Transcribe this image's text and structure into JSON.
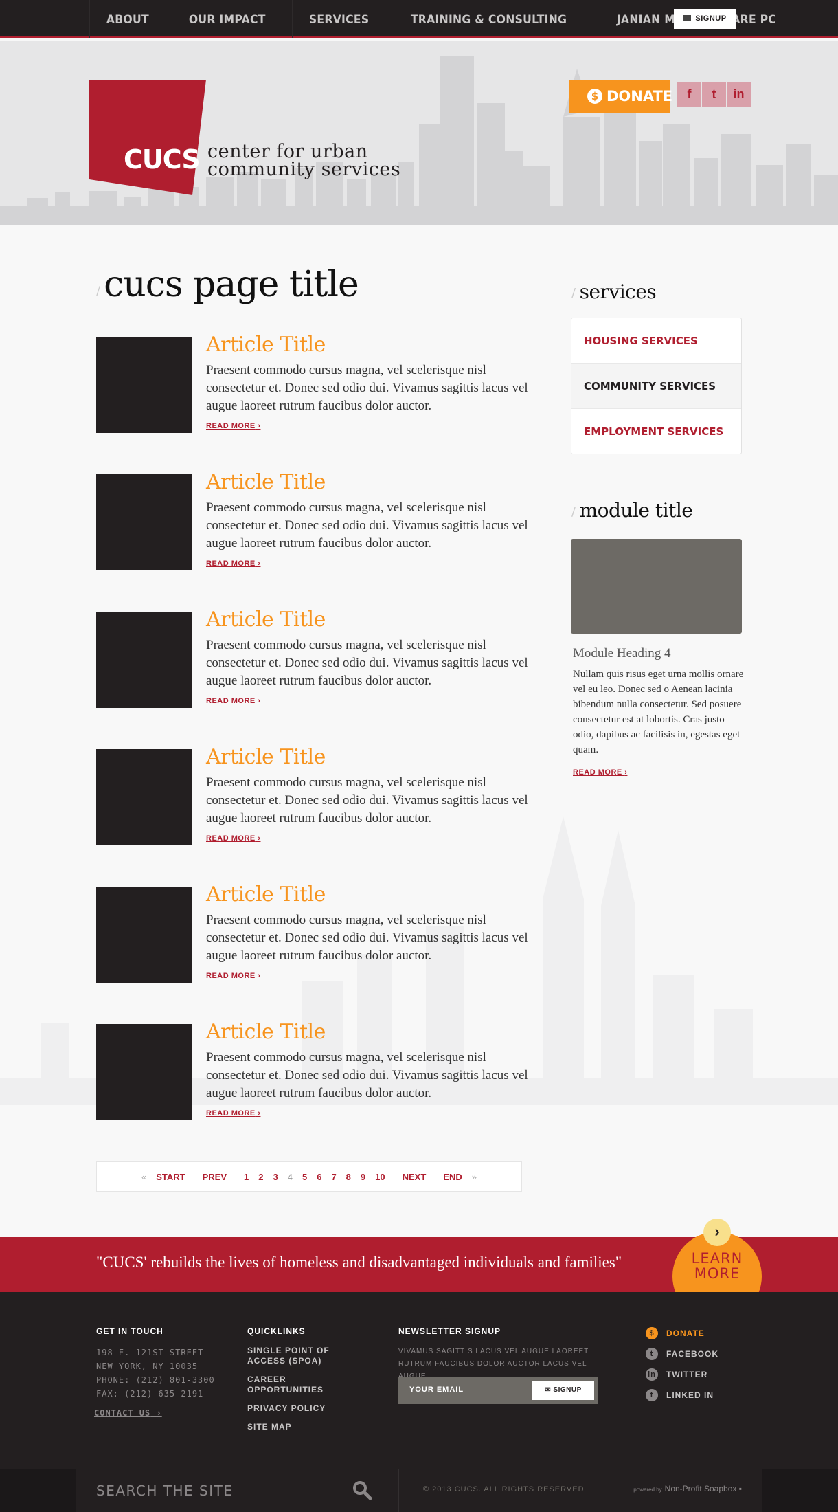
{
  "nav": {
    "items": [
      "ABOUT",
      "OUR IMPACT",
      "SERVICES",
      "TRAINING & CONSULTING",
      "JANIAN MEDICAL CARE PC"
    ],
    "signup_label": "SIGNUP"
  },
  "header": {
    "logo": "CUCS",
    "tagline_line1": "center for urban",
    "tagline_line2": "community services",
    "donate_label": "DONATE",
    "donate_icon": "$",
    "social_icons": [
      "f",
      "t",
      "in"
    ]
  },
  "main": {
    "page_title": "cucs page title",
    "articles": [
      {
        "title": "Article Title",
        "body": "Praesent commodo cursus magna, vel scelerisque nisl consectetur et. Donec sed odio dui. Vivamus sagittis lacus vel augue laoreet rutrum faucibus dolor auctor.",
        "more": "READ MORE"
      },
      {
        "title": "Article Title",
        "body": "Praesent commodo cursus magna, vel scelerisque nisl consectetur et. Donec sed odio dui. Vivamus sagittis lacus vel augue laoreet rutrum faucibus dolor auctor.",
        "more": "READ MORE"
      },
      {
        "title": "Article Title",
        "body": "Praesent commodo cursus magna, vel scelerisque nisl consectetur et. Donec sed odio dui. Vivamus sagittis lacus vel augue laoreet rutrum faucibus dolor auctor.",
        "more": "READ MORE"
      },
      {
        "title": "Article Title",
        "body": "Praesent commodo cursus magna, vel scelerisque nisl consectetur et. Donec sed odio dui. Vivamus sagittis lacus vel augue laoreet rutrum faucibus dolor auctor.",
        "more": "READ MORE"
      },
      {
        "title": "Article Title",
        "body": "Praesent commodo cursus magna, vel scelerisque nisl consectetur et. Donec sed odio dui. Vivamus sagittis lacus vel augue laoreet rutrum faucibus dolor auctor.",
        "more": "READ MORE"
      },
      {
        "title": "Article Title",
        "body": "Praesent commodo cursus magna, vel scelerisque nisl consectetur et. Donec sed odio dui. Vivamus sagittis lacus vel augue laoreet rutrum faucibus dolor auctor.",
        "more": "READ MORE"
      }
    ],
    "pager": {
      "first_arrow": "«",
      "start": "START",
      "prev": "PREV",
      "pages": [
        "1",
        "2",
        "3",
        "4",
        "5",
        "6",
        "7",
        "8",
        "9",
        "10"
      ],
      "current": "4",
      "next": "NEXT",
      "end": "END",
      "last_arrow": "»"
    }
  },
  "sidebar": {
    "services_title": "services",
    "services": [
      "HOUSING SERVICES",
      "COMMUNITY SERVICES",
      "EMPLOYMENT SERVICES"
    ],
    "active_service": "COMMUNITY SERVICES",
    "module_title": "module title",
    "module_heading": "Module Heading 4",
    "module_body": "Nullam quis risus eget urna mollis ornare vel eu leo. Donec sed o Aenean lacinia bibendum nulla consectetur. Sed posuere consectetur est at lobortis. Cras justo odio, dapibus ac facilisis in, egestas eget quam.",
    "module_more": "READ MORE"
  },
  "banner": {
    "quote": "\"CUCS' rebuilds the lives of homeless and disadvantaged individuals and families\"",
    "learn_line1": "LEARN",
    "learn_line2": "MORE"
  },
  "footer": {
    "contact_heading": "GET IN TOUCH",
    "address": [
      "198 E. 121ST STREET",
      "NEW YORK, NY 10035",
      "PHONE: (212) 801-3300",
      "FAX: (212) 635-2191"
    ],
    "contact_link": "CONTACT US",
    "quick_heading": "QUICKLINKS",
    "quicklinks": [
      "SINGLE POINT OF ACCESS (SPOA)",
      "CAREER OPPORTUNITIES",
      "PRIVACY POLICY",
      "SITE MAP"
    ],
    "news_heading": "NEWSLETTER SIGNUP",
    "news_text": "VIVAMUS SAGITTIS LACUS VEL AUGUE LAOREET RUTRUM FAUCIBUS DOLOR AUCTOR LACUS VEL AUGUE.",
    "email_placeholder": "YOUR EMAIL",
    "signup_label": "SIGNUP",
    "social": [
      {
        "label": "DONATE",
        "icon": "$"
      },
      {
        "label": "FACEBOOK",
        "icon": "t"
      },
      {
        "label": "TWITTER",
        "icon": "in"
      },
      {
        "label": "LINKED IN",
        "icon": "f"
      }
    ],
    "search_placeholder": "SEARCH THE SITE",
    "copyright": "© 2013 CUCS. ALL RIGHTS RESERVED",
    "powered_prefix": "powered by",
    "powered_name": "Non-Profit Soapbox"
  },
  "colors": {
    "brand_red": "#b01e2f",
    "accent_orange": "#f7941e",
    "dark": "#231f20"
  }
}
